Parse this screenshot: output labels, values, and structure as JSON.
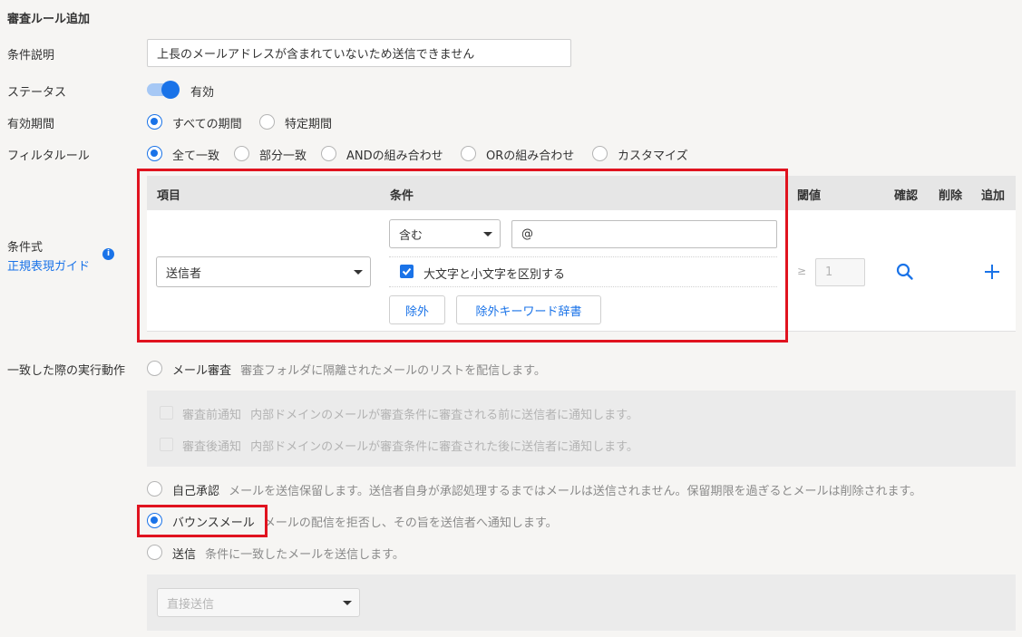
{
  "page_title": "審査ルール追加",
  "fields": {
    "description_label": "条件説明",
    "description_value": "上長のメールアドレスが含まれていないため送信できません",
    "status_label": "ステータス",
    "status_value": "有効",
    "period_label": "有効期間",
    "period_options": [
      "すべての期間",
      "特定期間"
    ],
    "filter_label": "フィルタルール",
    "filter_options": [
      "全て一致",
      "部分一致",
      "ANDの組み合わせ",
      "ORの組み合わせ",
      "カスタマイズ"
    ],
    "condition_label": "条件式",
    "regex_guide_link": "正規表現ガイド"
  },
  "table": {
    "headers": {
      "item": "項目",
      "condition": "条件",
      "threshold": "閾値",
      "confirm": "確認",
      "delete": "削除",
      "add": "追加"
    },
    "item_select": "送信者",
    "condition_select": "含む",
    "condition_value": "@",
    "case_sensitive_label": "大文字と小文字を区別する",
    "exclude_button": "除外",
    "exclude_dict_button": "除外キーワード辞書",
    "threshold_symbol": "≥",
    "threshold_placeholder": "1"
  },
  "actions": {
    "label": "一致した際の実行動作",
    "mail_review": {
      "title": "メール審査",
      "desc": "審査フォルダに隔離されたメールのリストを配信します。"
    },
    "pre_notify": {
      "title": "審査前通知",
      "desc": "内部ドメインのメールが審査条件に審査される前に送信者に通知します。"
    },
    "post_notify": {
      "title": "審査後通知",
      "desc": "内部ドメインのメールが審査条件に審査された後に送信者に通知します。"
    },
    "self_approval": {
      "title": "自己承認",
      "desc": "メールを送信保留します。送信者自身が承認処理するまではメールは送信されません。保留期限を過ぎるとメールは削除されます。"
    },
    "bounce": {
      "title": "バウンスメール",
      "desc": "メールの配信を拒否し、その旨を送信者へ通知します。"
    },
    "send": {
      "title": "送信",
      "desc": "条件に一致したメールを送信します。"
    },
    "send_select": "直接送信"
  },
  "colors": {
    "accent": "#1a73e8",
    "highlight": "#e0131f"
  }
}
